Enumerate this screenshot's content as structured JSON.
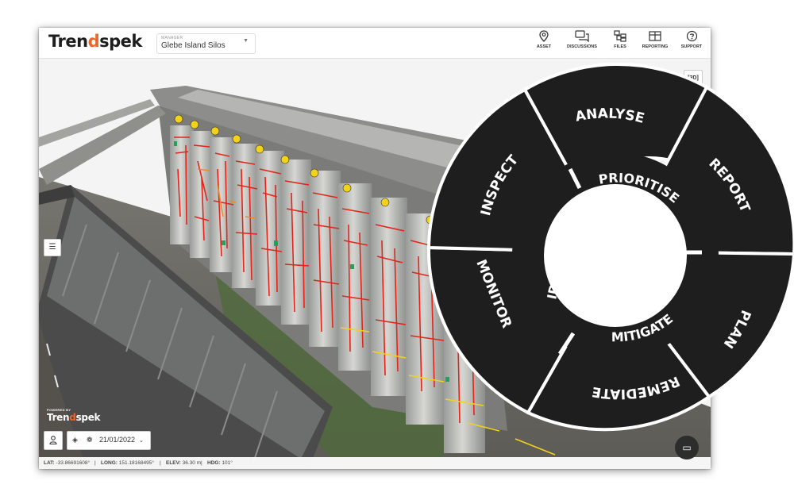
{
  "header": {
    "logo": {
      "prefix": "Tren",
      "accent": "d",
      "suffix": "spek"
    },
    "manager_caption": "MANAGER",
    "manager_value": "Glebe Island Silos",
    "nav": [
      {
        "label": "ASSET",
        "icon": "location-pin-icon"
      },
      {
        "label": "DISCUSSIONS",
        "icon": "chat-bubbles-icon"
      },
      {
        "label": "FILES",
        "icon": "files-tree-icon"
      },
      {
        "label": "REPORTING",
        "icon": "table-icon"
      },
      {
        "label": "SUPPORT",
        "icon": "help-circle-icon"
      }
    ]
  },
  "viewer": {
    "view_3d_label": "3D",
    "powered_by": "POWERED BY",
    "powered_logo": {
      "prefix": "Tren",
      "accent": "d",
      "suffix": "spek"
    },
    "date": "21/01/2022"
  },
  "statusbar": {
    "lat_label": "LAT:",
    "lat": "-33.86691608°",
    "long_label": "LONG:",
    "long": "151.18168495°",
    "elev_label": "ELEV:",
    "elev": "36.30 m",
    "hdg_label": "HDG:",
    "hdg": "101°"
  },
  "cycle": {
    "outer": [
      "ANALYSE",
      "REPORT",
      "PLAN",
      "REMEDIATE",
      "MONITOR",
      "INSPECT"
    ],
    "inner": [
      "PRIORITISE",
      "MITIGATE",
      "IDENTIFY"
    ]
  },
  "colors": {
    "brand_accent": "#e8652c",
    "wheel": "#1e1e1e",
    "defect_red": "#e3241b",
    "marker_yellow": "#f2d21b"
  }
}
